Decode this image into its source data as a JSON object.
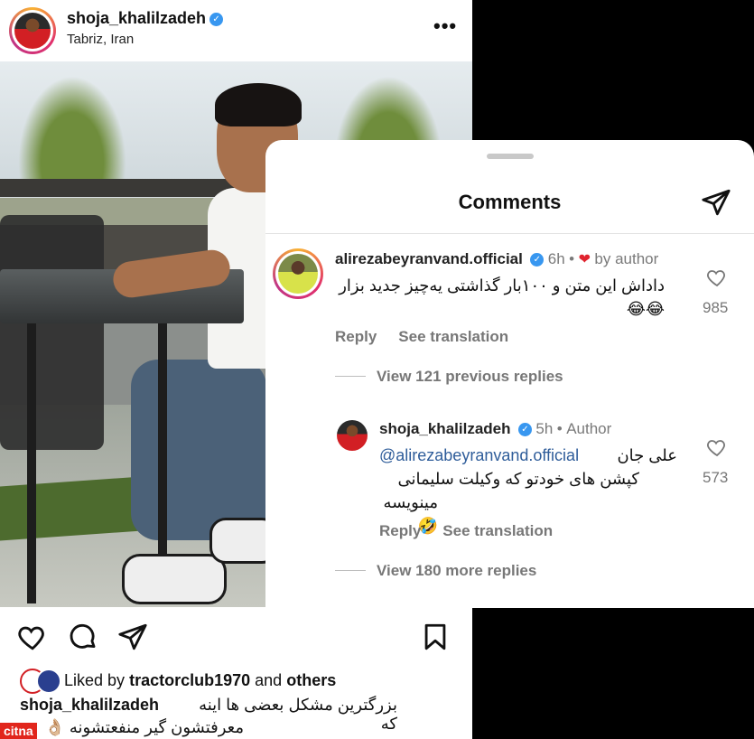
{
  "post": {
    "username": "shoja_khalilzadeh",
    "location": "Tabriz, Iran",
    "liked_by_prefix": "Liked by",
    "liked_by_user": "tractorclub1970",
    "liked_by_and": "and",
    "liked_by_others": "others",
    "caption_user": "shoja_khalilzadeh",
    "caption_line1": "بزرگترین مشکل بعضی ها اینه که",
    "caption_line2": "معرفتشون گیر منفعتشونه 👌🏼",
    "watermark": "citna"
  },
  "comments_panel": {
    "title": "Comments",
    "comments": [
      {
        "username": "alirezabeyranvand.official",
        "time": "6h",
        "badge": "by author",
        "text": "داداش این متن و ۱۰۰بار گذاشتی یه‌چیز جدید بزار 😂😂",
        "reply": "Reply",
        "see_translation": "See translation",
        "likes": "985",
        "view_replies": "View 121 previous replies"
      },
      {
        "username": "shoja_khalilzadeh",
        "time": "5h",
        "badge": "Author",
        "text_line1_arabic": "علی جان",
        "mention": "@alirezabeyranvand.official",
        "text_line2": "کپشن های خودتو که وکیلت سلیمانی",
        "text_line3": "مینویسه 🤣",
        "reply": "Reply",
        "see_translation": "See translation",
        "likes": "573",
        "view_replies": "View 180 more replies"
      }
    ]
  },
  "colors": {
    "verified": "#3897f0",
    "heart": "#e0242f",
    "mention": "#2f5d9a",
    "watermark_bg": "#e1261c"
  },
  "icons": [
    "verified-badge-icon",
    "more-options-icon",
    "heart-icon",
    "comment-icon",
    "share-icon",
    "bookmark-icon",
    "like-heart-icon",
    "red-heart-icon"
  ]
}
